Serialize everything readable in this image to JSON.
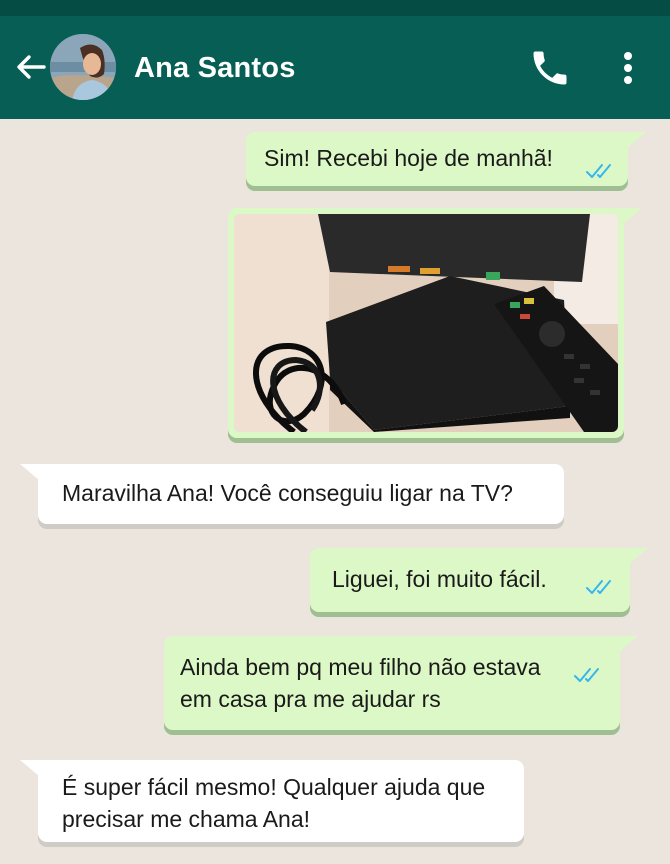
{
  "header": {
    "contact_name": "Ana Santos"
  },
  "messages": [
    {
      "direction": "out",
      "text": "Sim! Recebi hoje de manhã!",
      "status": "read"
    },
    {
      "direction": "out",
      "type": "image",
      "image": "tv-box-with-remote-photo"
    },
    {
      "direction": "in",
      "text": "Maravilha Ana! Você conseguiu ligar na TV?"
    },
    {
      "direction": "out",
      "text": "Liguei, foi muito fácil.",
      "status": "read"
    },
    {
      "direction": "out",
      "lines": [
        "Ainda bem pq meu filho não estava",
        "em casa pra me ajudar rs"
      ],
      "status": "read"
    },
    {
      "direction": "in",
      "lines": [
        "É super fácil mesmo! Qualquer ajuda que",
        "precisar me chama Ana!"
      ]
    }
  ],
  "icons": [
    "back-arrow-icon",
    "phone-icon",
    "more-vert-icon",
    "double-check-icon"
  ],
  "colors": {
    "header": "#075e54",
    "background": "#ece5dd",
    "outgoing": "#dcf8c6",
    "incoming": "#ffffff",
    "read_ticks": "#34b7f1"
  }
}
